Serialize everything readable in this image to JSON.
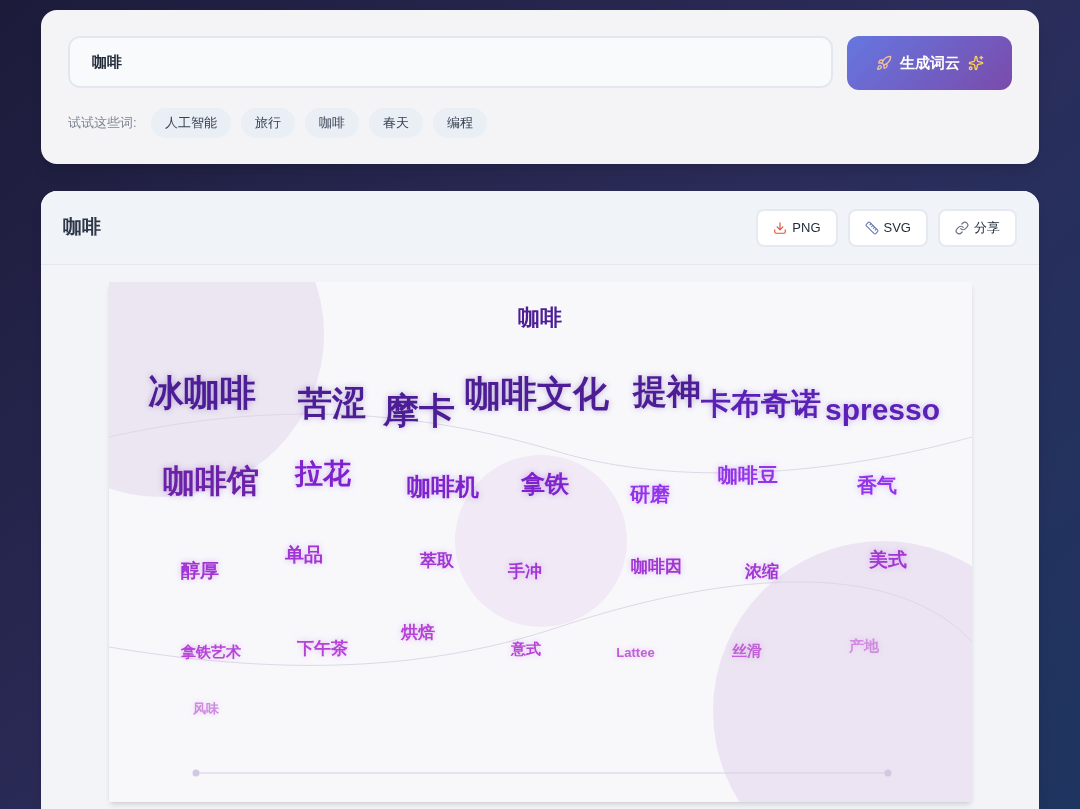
{
  "search": {
    "value": "咖啡",
    "button": "生成词云"
  },
  "suggestions": {
    "label": "试试这些词:",
    "chips": [
      "人工智能",
      "旅行",
      "咖啡",
      "春天",
      "编程"
    ]
  },
  "result": {
    "title": "咖啡",
    "actions": [
      {
        "kind": "png",
        "label": "PNG"
      },
      {
        "kind": "svg",
        "label": "SVG"
      },
      {
        "kind": "share",
        "label": "分享"
      }
    ]
  },
  "cloud": {
    "title": "咖啡",
    "words": [
      {
        "text": "冰咖啡",
        "color": "#4c1d95"
      },
      {
        "text": "苦涩",
        "color": "#4c1d95"
      },
      {
        "text": "摩卡",
        "color": "#4c1d95"
      },
      {
        "text": "咖啡文化",
        "color": "#4c1d95"
      },
      {
        "text": "提神",
        "color": "#4c1d95"
      },
      {
        "text": "卡布奇诺",
        "color": "#5b21b6"
      },
      {
        "text": "spresso",
        "color": "#5b21b6"
      },
      {
        "text": "咖啡馆",
        "color": "#6b21a8"
      },
      {
        "text": "拉花",
        "color": "#7e22ce"
      },
      {
        "text": "咖啡机",
        "color": "#7e22ce"
      },
      {
        "text": "拿铁",
        "color": "#7e22ce"
      },
      {
        "text": "研磨",
        "color": "#9333ea"
      },
      {
        "text": "咖啡豆",
        "color": "#9333ea"
      },
      {
        "text": "香气",
        "color": "#9333ea"
      },
      {
        "text": "醇厚",
        "color": "#a236d4"
      },
      {
        "text": "单品",
        "color": "#a236d4"
      },
      {
        "text": "萃取",
        "color": "#a236d4"
      },
      {
        "text": "手冲",
        "color": "#a236d4"
      },
      {
        "text": "咖啡因",
        "color": "#a236d4"
      },
      {
        "text": "浓缩",
        "color": "#a236d4"
      },
      {
        "text": "美式",
        "color": "#a236d4"
      },
      {
        "text": "拿铁艺术",
        "color": "#b544d6"
      },
      {
        "text": "下午茶",
        "color": "#b544d6"
      },
      {
        "text": "烘焙",
        "color": "#b544d6"
      },
      {
        "text": "意式",
        "color": "#b544d6"
      },
      {
        "text": "Lattee",
        "color": "#c061d8"
      },
      {
        "text": "丝滑",
        "color": "#c061d8"
      },
      {
        "text": "产地",
        "color": "#d08ae0"
      },
      {
        "text": "风味",
        "color": "#d08ae0"
      }
    ]
  }
}
